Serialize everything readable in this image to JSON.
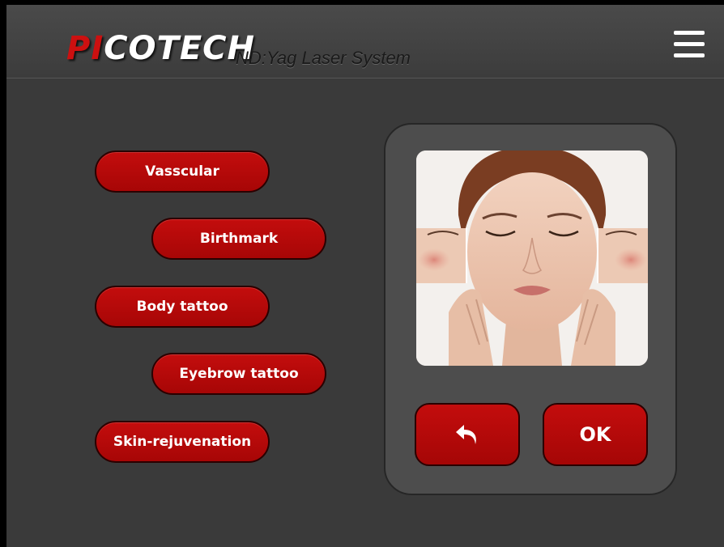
{
  "header": {
    "logo_red": "PI",
    "logo_white": "COTECH",
    "subtitle": "ND:Yag Laser System",
    "menu_icon": "hamburger-menu-icon"
  },
  "treatments": [
    {
      "label": "Vasscular"
    },
    {
      "label": "Birthmark"
    },
    {
      "label": "Body tattoo"
    },
    {
      "label": "Eyebrow tattoo"
    },
    {
      "label": "Skin-rejuvenation"
    }
  ],
  "preview": {
    "image": "face-skin-treatment-photo",
    "back_icon": "undo-arrow-icon",
    "ok_label": "OK"
  },
  "colors": {
    "accent": "#b50808",
    "background": "#3a3a3a",
    "panel": "#4d4d4d"
  }
}
